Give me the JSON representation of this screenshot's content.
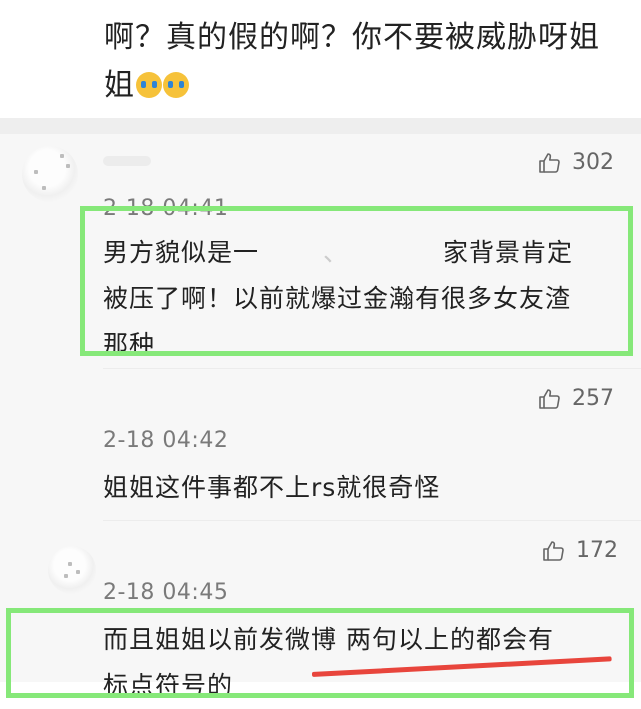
{
  "top_comment": {
    "text": "啊？真的假的啊？你不要被威胁呀姐姐",
    "emoji_count": 2,
    "emoji_names": [
      "loudly-crying-face",
      "loudly-crying-face"
    ]
  },
  "replies": [
    {
      "likes": "302",
      "time": "2-18 04:41",
      "text_line1_start": "男方貌似是一",
      "text_line1_mid": "、",
      "text_line1_end": "家背景肯定",
      "text_line2": "被压了啊！以前就爆过金瀚有很多女友渣",
      "text_line3": "那种",
      "highlighted": true
    },
    {
      "likes": "257",
      "time": "2-18 04:42",
      "text": "姐姐这件事都不上rs就很奇怪",
      "highlighted": false
    },
    {
      "likes": "172",
      "time": "2-18 04:45",
      "text_line1": "而且姐姐以前发微博 两句以上的都会有",
      "text_line2": "标点符号的",
      "highlighted": true
    }
  ],
  "colors": {
    "highlight_box": "#86e879",
    "annotation_line": "#e8453c",
    "time_text": "#7a7a7a",
    "like_text": "#666666"
  },
  "icons": [
    "thumbs-up-icon",
    "avatar"
  ]
}
